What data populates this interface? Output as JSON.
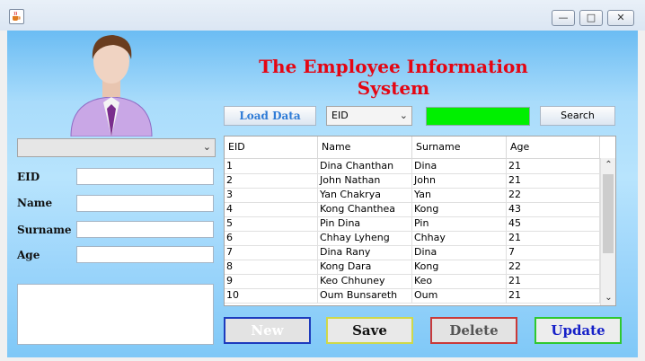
{
  "window": {
    "icon": "java-cup-icon",
    "controls": [
      "minimize-icon",
      "maximize-icon",
      "close-icon"
    ]
  },
  "header": {
    "title": "The Employee Information System"
  },
  "avatar": {
    "icon": "employee-avatar-icon"
  },
  "form": {
    "selector_value": "",
    "labels": {
      "eid": "EID",
      "name": "Name",
      "surname": "Surname",
      "age": "Age"
    },
    "values": {
      "eid": "",
      "name": "",
      "surname": "",
      "age": ""
    },
    "notes": ""
  },
  "toolbar": {
    "load_label": "Load Data",
    "search_field_selected": "EID",
    "search_value": "",
    "search_label": "Search",
    "search_color": "#00f000"
  },
  "table": {
    "columns": [
      "EID",
      "Name",
      "Surname",
      "Age"
    ],
    "rows": [
      [
        "1",
        "Dina Chanthan",
        "Dina",
        "21"
      ],
      [
        "2",
        "John Nathan",
        "John",
        "21"
      ],
      [
        "3",
        "Yan Chakrya",
        "Yan",
        "22"
      ],
      [
        "4",
        "Kong Chanthea",
        "Kong",
        "43"
      ],
      [
        "5",
        "Pin Dina",
        "Pin",
        "45"
      ],
      [
        "6",
        "Chhay Lyheng",
        "Chhay",
        "21"
      ],
      [
        "7",
        "Dina Rany",
        "Dina",
        "7"
      ],
      [
        "8",
        "Kong Dara",
        "Kong",
        "22"
      ],
      [
        "9",
        "Keo Chhuney",
        "Keo",
        "21"
      ],
      [
        "10",
        "Oum Bunsareth",
        "Oum",
        "21"
      ]
    ]
  },
  "actions": {
    "new_label": "New",
    "save_label": "Save",
    "delete_label": "Delete",
    "update_label": "Update"
  },
  "colors": {
    "title": "#e40613",
    "load": "#2e7bd6",
    "update": "#1620c8"
  }
}
